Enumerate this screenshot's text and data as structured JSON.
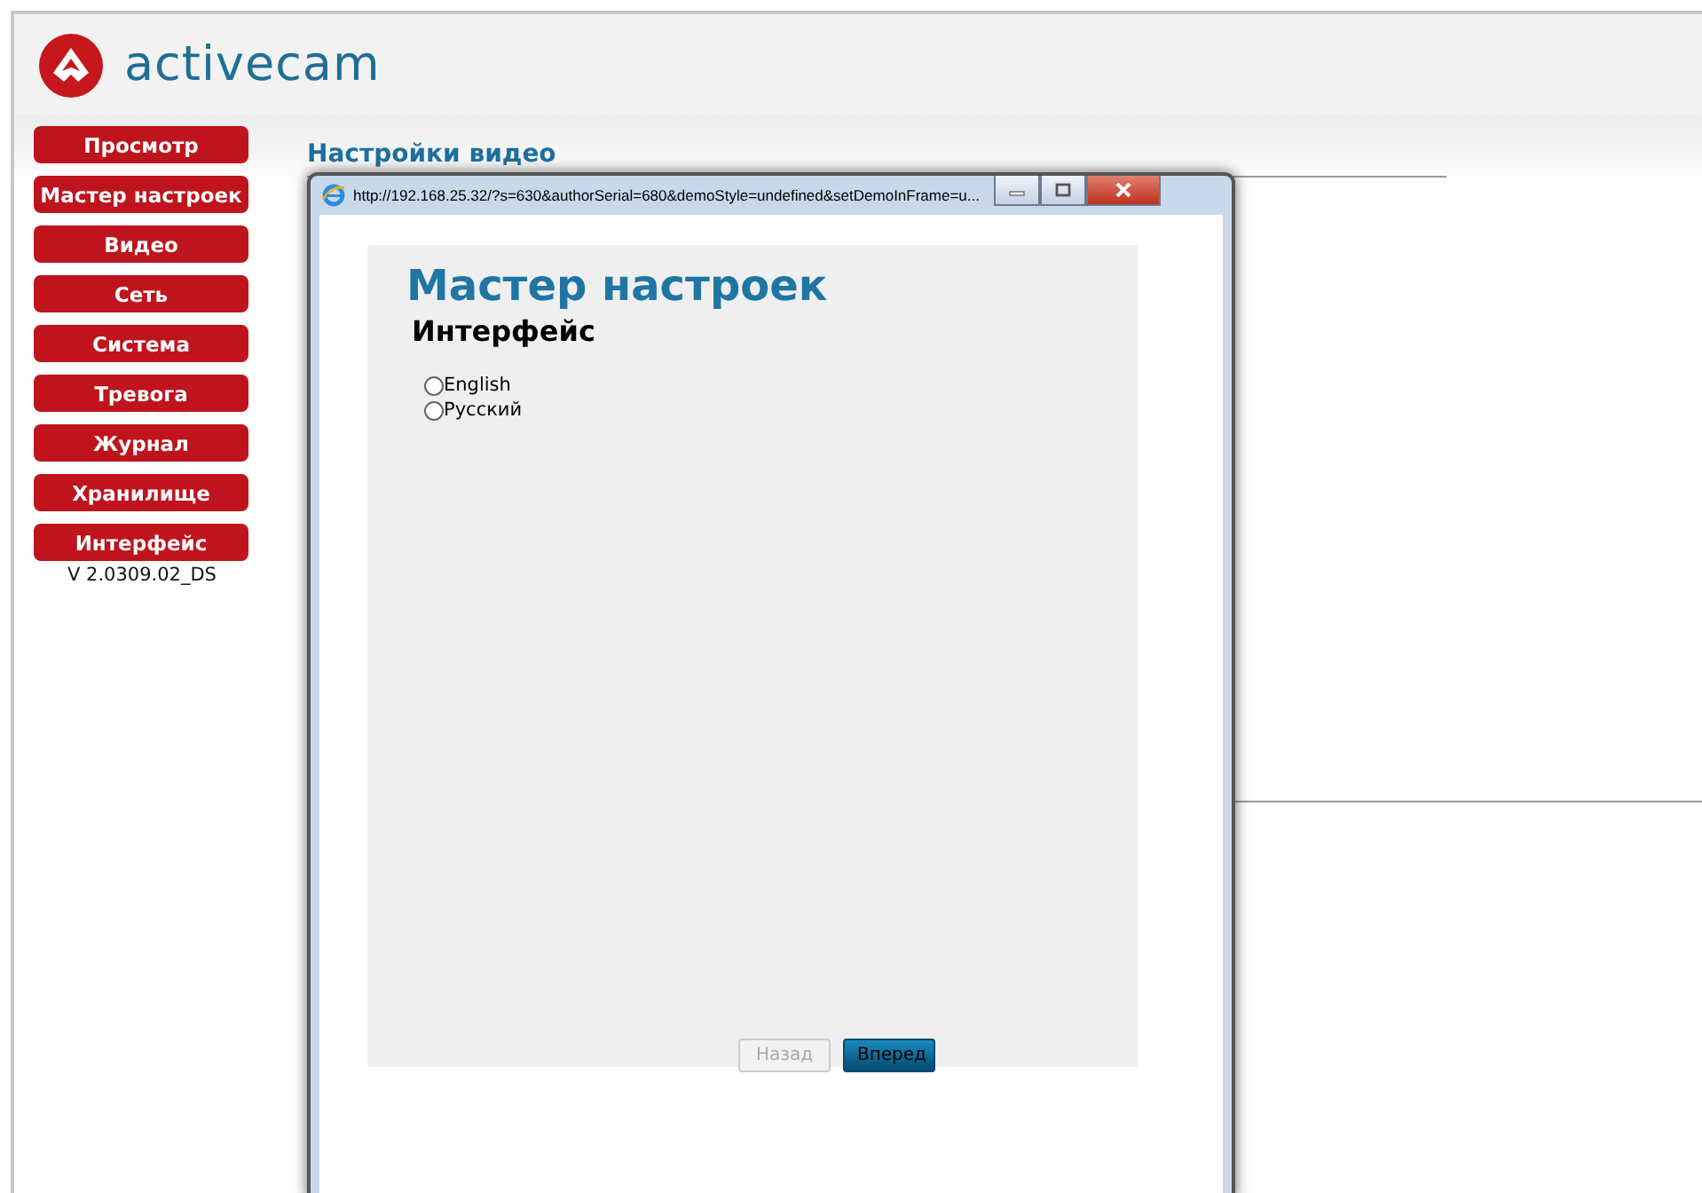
{
  "header": {
    "logo_text": "activecam"
  },
  "sidebar": {
    "items": [
      {
        "label": "Просмотр"
      },
      {
        "label": "Мастер настроек"
      },
      {
        "label": "Видео"
      },
      {
        "label": "Сеть"
      },
      {
        "label": "Система"
      },
      {
        "label": "Тревога"
      },
      {
        "label": "Журнал"
      },
      {
        "label": "Хранилище"
      },
      {
        "label": "Интерфейс"
      }
    ],
    "version": "V 2.0309.02_DS"
  },
  "main": {
    "title": "Настройки видео"
  },
  "popup": {
    "url": "http://192.168.25.32/?s=630&authorSerial=680&demoStyle=undefined&setDemoInFrame=u...",
    "heading": "Мастер настроек",
    "subheading": "Интерфейс",
    "options": [
      {
        "label": "English",
        "selected": false
      },
      {
        "label": "Русский",
        "selected": false
      }
    ],
    "buttons": [
      {
        "label": "Назад",
        "disabled": true
      },
      {
        "label": "Вперед",
        "disabled": false
      }
    ]
  }
}
